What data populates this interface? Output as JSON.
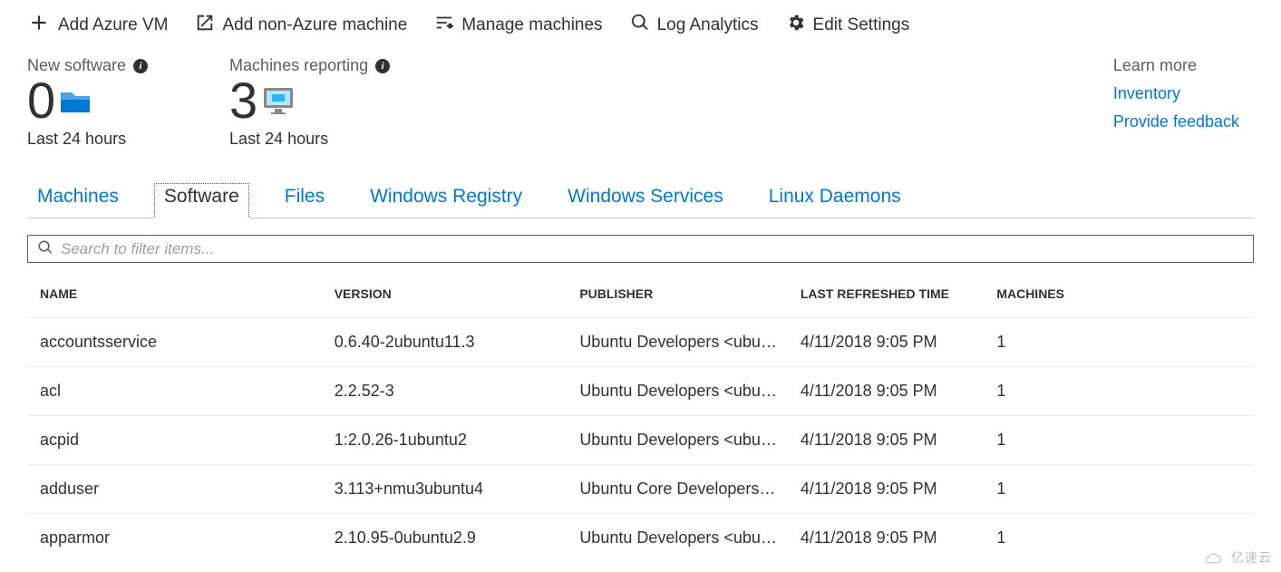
{
  "toolbar": {
    "add_azure_vm": "Add Azure VM",
    "add_non_azure": "Add non-Azure machine",
    "manage_machines": "Manage machines",
    "log_analytics": "Log Analytics",
    "edit_settings": "Edit Settings"
  },
  "stats": {
    "new_software": {
      "label": "New software",
      "value": "0",
      "sub": "Last 24 hours"
    },
    "machines_reporting": {
      "label": "Machines reporting",
      "value": "3",
      "sub": "Last 24 hours"
    }
  },
  "links": {
    "header": "Learn more",
    "inventory": "Inventory",
    "feedback": "Provide feedback"
  },
  "tabs": {
    "machines": "Machines",
    "software": "Software",
    "files": "Files",
    "windows_registry": "Windows Registry",
    "windows_services": "Windows Services",
    "linux_daemons": "Linux Daemons"
  },
  "search": {
    "placeholder": "Search to filter items..."
  },
  "table": {
    "headers": {
      "name": "NAME",
      "version": "VERSION",
      "publisher": "PUBLISHER",
      "last_refreshed": "LAST REFRESHED TIME",
      "machines": "MACHINES"
    },
    "rows": [
      {
        "name": "accountsservice",
        "version": "0.6.40-2ubuntu11.3",
        "publisher": "Ubuntu Developers <ubun…",
        "time": "4/11/2018 9:05 PM",
        "machines": "1"
      },
      {
        "name": "acl",
        "version": "2.2.52-3",
        "publisher": "Ubuntu Developers <ubun…",
        "time": "4/11/2018 9:05 PM",
        "machines": "1"
      },
      {
        "name": "acpid",
        "version": "1:2.0.26-1ubuntu2",
        "publisher": "Ubuntu Developers <ubun…",
        "time": "4/11/2018 9:05 PM",
        "machines": "1"
      },
      {
        "name": "adduser",
        "version": "3.113+nmu3ubuntu4",
        "publisher": "Ubuntu Core Developers…",
        "time": "4/11/2018 9:05 PM",
        "machines": "1"
      },
      {
        "name": "apparmor",
        "version": "2.10.95-0ubuntu2.9",
        "publisher": "Ubuntu Developers <ubun…",
        "time": "4/11/2018 9:05 PM",
        "machines": "1"
      }
    ]
  },
  "watermark": "亿速云"
}
